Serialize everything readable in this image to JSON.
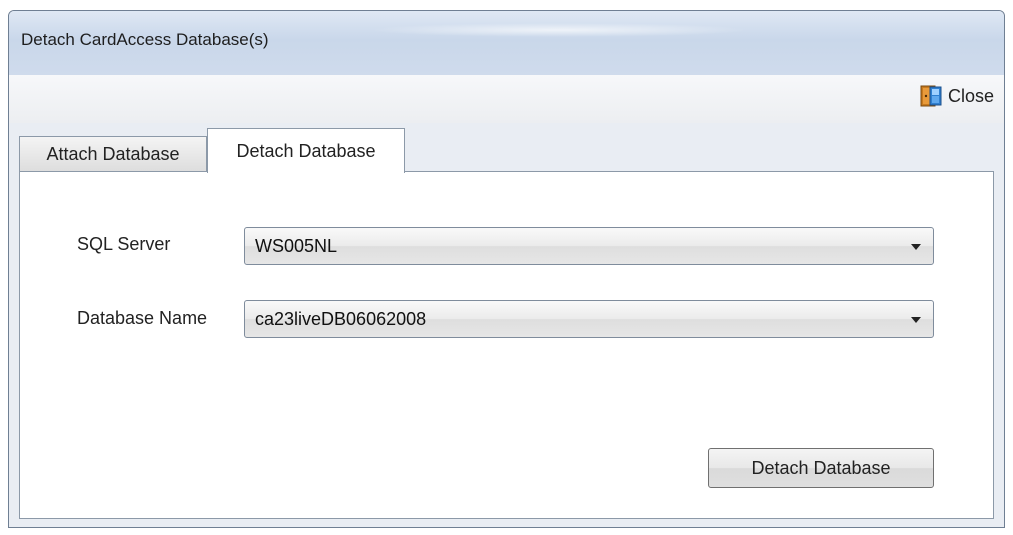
{
  "window": {
    "title": "Detach CardAccess Database(s)"
  },
  "toolbar": {
    "close_label": "Close",
    "close_icon": "door-exit-icon"
  },
  "tabs": [
    {
      "label": "Attach Database",
      "selected": false
    },
    {
      "label": "Detach Database",
      "selected": true
    }
  ],
  "form": {
    "sql_server_label": "SQL Server",
    "sql_server_value": "WS005NL",
    "database_name_label": "Database Name",
    "database_name_value": "ca23liveDB06062008",
    "detach_button_label": "Detach Database"
  },
  "colors": {
    "titlebar": "#c9d7ea",
    "window_border": "#6f7f93",
    "tab_page_bg": "#ffffff"
  }
}
